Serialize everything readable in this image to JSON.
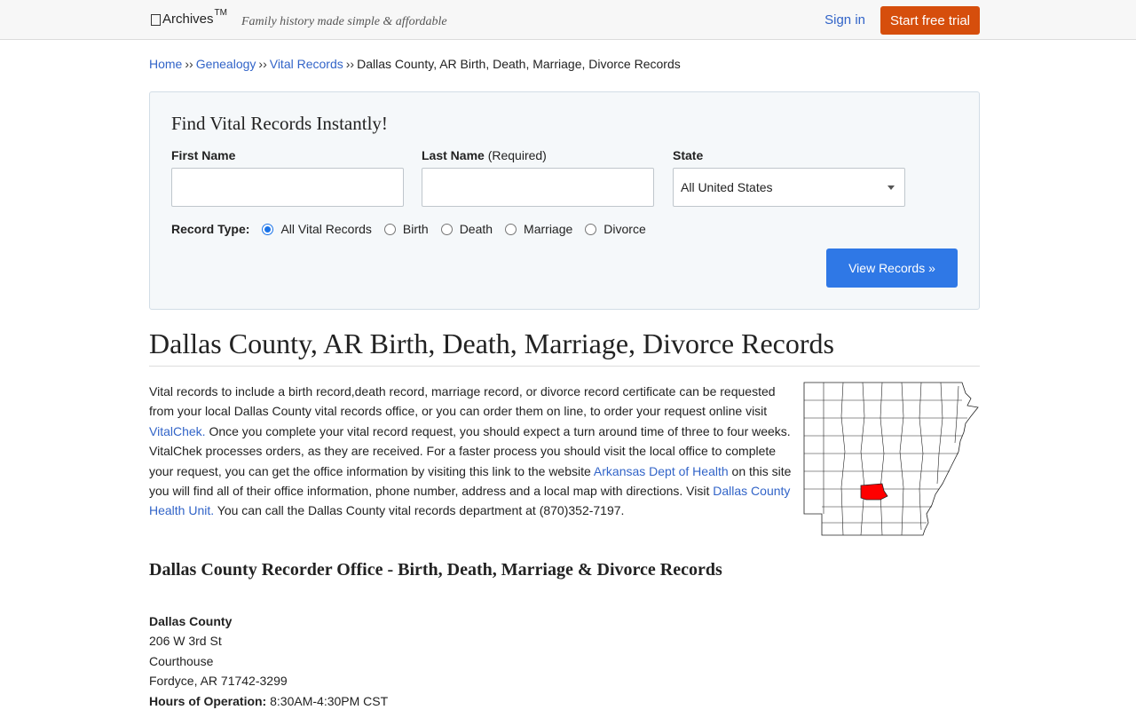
{
  "header": {
    "logo_text": "Archives",
    "logo_sup": "TM",
    "tagline": "Family history made simple & affordable",
    "signin": "Sign in",
    "trial": "Start free trial"
  },
  "breadcrumb": {
    "home": "Home",
    "genealogy": "Genealogy",
    "vital": "Vital Records",
    "current": "Dallas County, AR Birth, Death, Marriage, Divorce Records",
    "separator": "››"
  },
  "search": {
    "title": "Find Vital Records Instantly!",
    "first_name_label": "First Name",
    "last_name_label": "Last Name",
    "last_name_note": "(Required)",
    "state_label": "State",
    "state_value": "All United States",
    "record_type_label": "Record Type:",
    "record_types": [
      "All Vital Records",
      "Birth",
      "Death",
      "Marriage",
      "Divorce"
    ],
    "selected_record_type": "All Vital Records",
    "button": "View Records »"
  },
  "main": {
    "title": "Dallas County, AR Birth, Death, Marriage, Divorce Records",
    "p1": "Vital records to include a birth record,death record, marriage record, or divorce record certificate can be requested from your local Dallas County vital records office, or you can order them on line, to order your request online visit ",
    "link_vitalchek": "VitalChek.",
    "p2": " Once you complete your vital record request, you should expect a turn around time of three to four weeks. VitalChek processes orders, as they are received. For a faster process you should visit the local office to complete your request, you can get the office information by visiting this link to the website ",
    "link_health": "Arkansas Dept of Health",
    "p3": " on this site you will find all of their office information, phone number, address and a local map with directions. Visit ",
    "link_unit": "Dallas County Health Unit.",
    "p4": " You can call the Dallas County vital records department at (870)352-7197."
  },
  "office": {
    "section_title": "Dallas County Recorder Office - Birth, Death, Marriage & Divorce Records",
    "name": "Dallas County",
    "street": "206 W 3rd St",
    "building": "Courthouse",
    "city": "Fordyce, AR 71742-3299",
    "hours_label": "Hours of Operation:",
    "hours": "8:30AM-4:30PM CST"
  },
  "map": {
    "highlight_color": "#ff0000",
    "icon": "arkansas-county-map"
  }
}
